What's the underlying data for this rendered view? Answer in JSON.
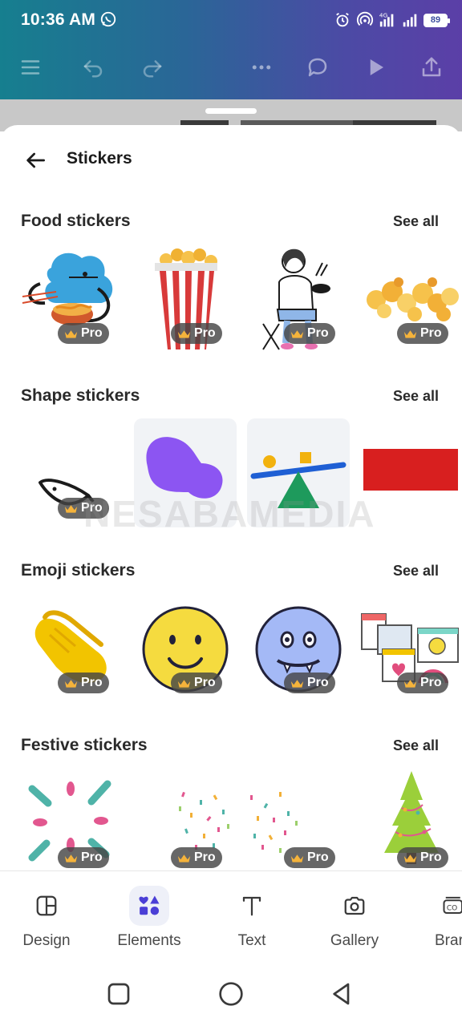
{
  "status_bar": {
    "time": "10:36 AM",
    "network": "4G",
    "battery": "89"
  },
  "sheet": {
    "title": "Stickers"
  },
  "sections": [
    {
      "title": "Food stickers",
      "see_all": "See all",
      "items": [
        {
          "name": "food-sticker-blob-noodles",
          "pro": "Pro"
        },
        {
          "name": "food-sticker-popcorn-box",
          "pro": "Pro"
        },
        {
          "name": "food-sticker-woman-eating",
          "pro": "Pro"
        },
        {
          "name": "food-sticker-popcorn-pile",
          "pro": "Pro"
        }
      ]
    },
    {
      "title": "Shape stickers",
      "see_all": "See all",
      "items": [
        {
          "name": "shape-sticker-hand-drawn",
          "pro": "Pro"
        },
        {
          "name": "shape-sticker-purple-blob",
          "pro": ""
        },
        {
          "name": "shape-sticker-seesaw",
          "pro": ""
        },
        {
          "name": "shape-sticker-red-rectangle",
          "pro": ""
        }
      ]
    },
    {
      "title": "Emoji stickers",
      "see_all": "See all",
      "items": [
        {
          "name": "emoji-sticker-clapping-hands",
          "pro": "Pro"
        },
        {
          "name": "emoji-sticker-smiley",
          "pro": "Pro"
        },
        {
          "name": "emoji-sticker-vampire-face",
          "pro": "Pro"
        },
        {
          "name": "emoji-sticker-web-windows",
          "pro": "Pro"
        }
      ]
    },
    {
      "title": "Festive stickers",
      "see_all": "See all",
      "items": [
        {
          "name": "festive-sticker-burst",
          "pro": "Pro"
        },
        {
          "name": "festive-sticker-confetti",
          "pro": "Pro"
        },
        {
          "name": "festive-sticker-confetti-2",
          "pro": "Pro"
        },
        {
          "name": "festive-sticker-tree",
          "pro": "Pro"
        }
      ]
    }
  ],
  "watermark": "NESABAMEDIA",
  "bottom_nav": [
    {
      "label": "Design",
      "icon": "design-icon",
      "active": false
    },
    {
      "label": "Elements",
      "icon": "elements-icon",
      "active": true
    },
    {
      "label": "Text",
      "icon": "text-icon",
      "active": false
    },
    {
      "label": "Gallery",
      "icon": "camera-icon",
      "active": false
    },
    {
      "label": "Brar",
      "icon": "brand-icon",
      "active": false
    }
  ],
  "colors": {
    "header_gradient_start": "#167f8f",
    "header_gradient_end": "#5b3fa7",
    "accent": "#4b3fd6"
  }
}
